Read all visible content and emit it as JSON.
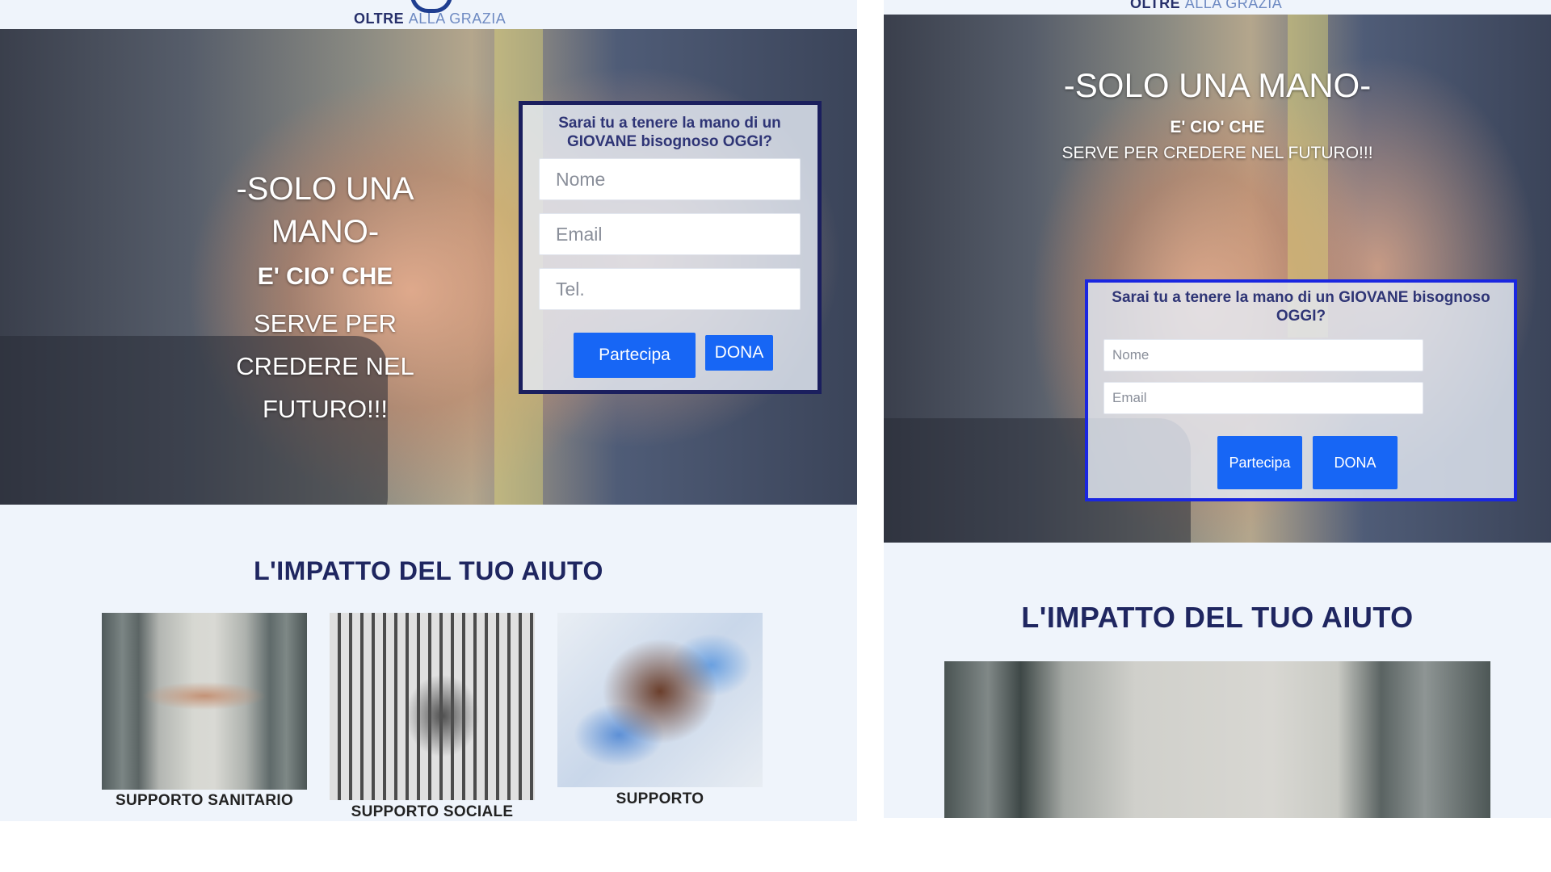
{
  "brand": {
    "name_bold": "OLTRE",
    "name_light": "ALLA GRAZIA"
  },
  "left": {
    "hero_title": "-SOLO UNA MANO-",
    "hero_sub_bold": "E'  CIO' CHE",
    "hero_sub": "SERVE PER CREDERE NEL FUTURO!!!",
    "form_question": "Sarai tu a tenere la mano di un GIOVANE bisognoso OGGI?",
    "field_name_placeholder": "Nome",
    "field_email_placeholder": "Email",
    "field_tel_placeholder": "Tel.",
    "btn_partecipa": "Partecipa",
    "btn_dona": "DONA",
    "section_title": "L'IMPATTO DEL TUO AIUTO",
    "cards": [
      {
        "label": "SUPPORTO SANITARIO"
      },
      {
        "label": "SUPPORTO SOCIALE"
      },
      {
        "label": "SUPPORTO"
      }
    ]
  },
  "right": {
    "hero_title": "-SOLO UNA MANO-",
    "hero_sub_bold": "E'  CIO' CHE",
    "hero_sub": "SERVE PER CREDERE NEL FUTURO!!!",
    "form_question": "Sarai tu a tenere la mano di un GIOVANE bisognoso OGGI?",
    "field_name_placeholder": "Nome",
    "field_email_placeholder": "Email",
    "btn_partecipa": "Partecipa",
    "btn_dona": "DONA",
    "section_title": "L'IMPATTO DEL TUO AIUTO"
  },
  "colors": {
    "accent_blue": "#1766f5",
    "title_navy": "#1f2660",
    "form_border_left": "#1b1f5e",
    "form_border_right": "#1a26e0"
  }
}
